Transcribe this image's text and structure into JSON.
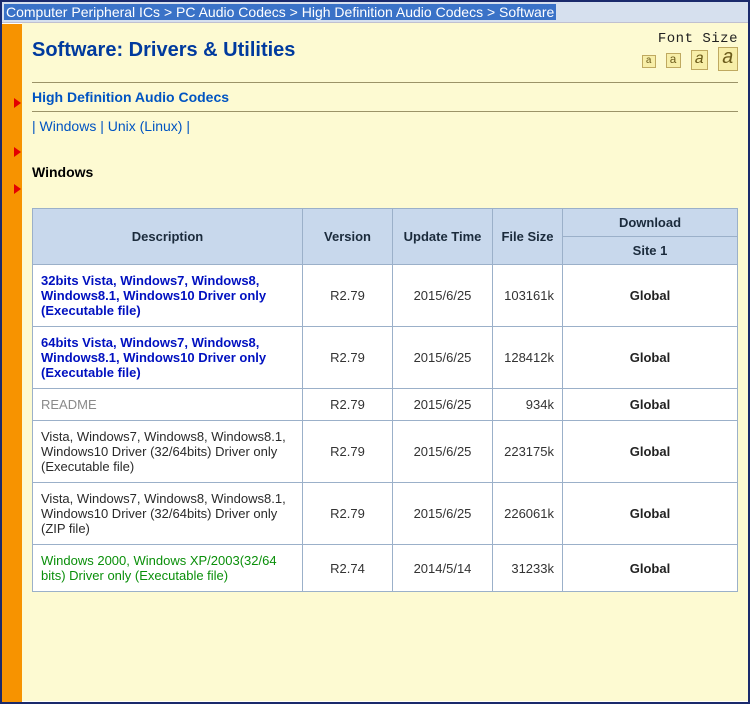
{
  "breadcrumb": {
    "items": [
      "Computer Peripheral ICs",
      "PC Audio Codecs",
      "High Definition Audio Codecs",
      "Software"
    ],
    "sep": " > "
  },
  "page": {
    "title": "Software: Drivers & Utilities",
    "font_size_label": "Font Size"
  },
  "section_link": "High Definition Audio Codecs",
  "os_nav": {
    "sep": " | ",
    "items": [
      "Windows",
      "Unix (Linux)"
    ]
  },
  "os_heading": "Windows",
  "table": {
    "headers": {
      "description": "Description",
      "version": "Version",
      "update_time": "Update Time",
      "file_size": "File Size",
      "download": "Download",
      "site1": "Site 1"
    },
    "rows": [
      {
        "desc": "32bits Vista, Windows7, Windows8, Windows8.1, Windows10 Driver only (Executable file)",
        "desc_class": "link-blue",
        "version": "R2.79",
        "time": "2015/6/25",
        "size": "103161k",
        "site": "Global"
      },
      {
        "desc": "64bits Vista, Windows7, Windows8, Windows8.1, Windows10 Driver only (Executable file)",
        "desc_class": "link-blue",
        "version": "R2.79",
        "time": "2015/6/25",
        "size": "128412k",
        "site": "Global"
      },
      {
        "desc": "README",
        "desc_class": "link-gray",
        "version": "R2.79",
        "time": "2015/6/25",
        "size": "934k",
        "site": "Global"
      },
      {
        "desc": "Vista, Windows7, Windows8, Windows8.1, Windows10 Driver (32/64bits) Driver only (Executable file)",
        "desc_class": "link-dark",
        "version": "R2.79",
        "time": "2015/6/25",
        "size": "223175k",
        "site": "Global"
      },
      {
        "desc": "Vista, Windows7, Windows8, Windows8.1, Windows10 Driver (32/64bits) Driver only (ZIP file)",
        "desc_class": "link-dark",
        "version": "R2.79",
        "time": "2015/6/25",
        "size": "226061k",
        "site": "Global"
      },
      {
        "desc": "Windows 2000, Windows XP/2003(32/64 bits) Driver only (Executable file)",
        "desc_class": "link-green",
        "version": "R2.74",
        "time": "2014/5/14",
        "size": "31233k",
        "site": "Global"
      }
    ]
  }
}
